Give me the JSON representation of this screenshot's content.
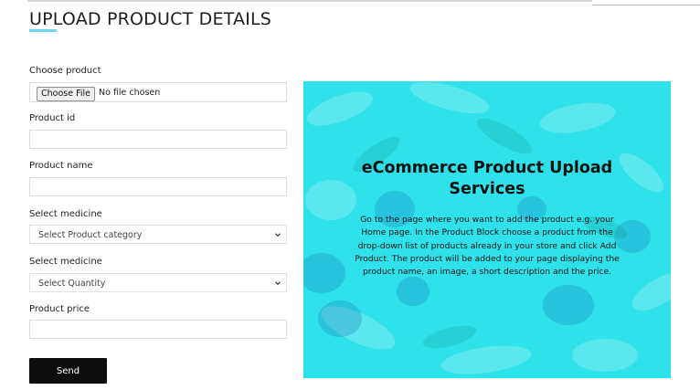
{
  "page": {
    "title": "UPLOAD PRODUCT DETAILS",
    "accent_color": "#6fd3ec"
  },
  "form": {
    "choose_product": {
      "label": "Choose product",
      "button_label": "Choose File",
      "status_text": "No file chosen"
    },
    "product_id": {
      "label": "Product id",
      "value": ""
    },
    "product_name": {
      "label": "Product name",
      "value": ""
    },
    "category_select": {
      "label": "Select medicine",
      "selected": "Select Product category",
      "icon": "chevron-down-icon"
    },
    "quantity_select": {
      "label": "Select medicine",
      "selected": "Select Quantity",
      "icon": "chevron-down-icon"
    },
    "product_price": {
      "label": "Product price",
      "value": ""
    },
    "submit": {
      "label": "Send",
      "color": "#0e0e0e"
    }
  },
  "promo": {
    "background_color": "#2ee1ea",
    "heading": "eCommerce Product Upload Services",
    "body": "Go to the page where you want to add the product e.g. your Home page. In the Product Block choose a product from the drop-down list of products already in your store and click Add Product. The product will be added to your page displaying the product name, an image, a short description and the price."
  }
}
